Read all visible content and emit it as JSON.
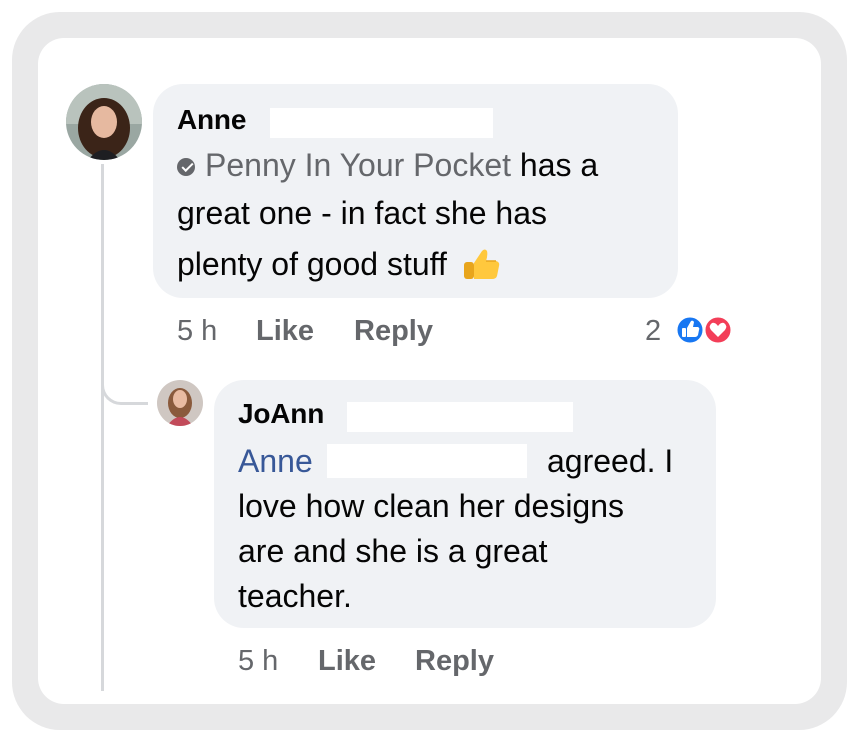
{
  "comment1": {
    "author": "Anne",
    "mention_page": "Penny In Your Pocket",
    "text_line1_rest": " has a",
    "text_line2": "great one - in fact she has",
    "text_line3": "plenty of good stuff",
    "emoji": "thumbs-up",
    "time": "5 h",
    "like_label": "Like",
    "reply_label": "Reply",
    "reaction_count": "2",
    "reactions": [
      "like-icon",
      "love-icon"
    ]
  },
  "comment2": {
    "author": "JoAnn",
    "mention": "Anne",
    "text_line1_rest": "agreed. I",
    "text_line2": "love how clean her designs",
    "text_line3": "are and she is a great",
    "text_line4": "teacher.",
    "time": "5 h",
    "like_label": "Like",
    "reply_label": "Reply"
  },
  "colors": {
    "bubble": "#f0f2f5",
    "link": "#385898",
    "muted": "#65676b",
    "like_blue": "#1877f2",
    "love_red": "#f33e58"
  }
}
